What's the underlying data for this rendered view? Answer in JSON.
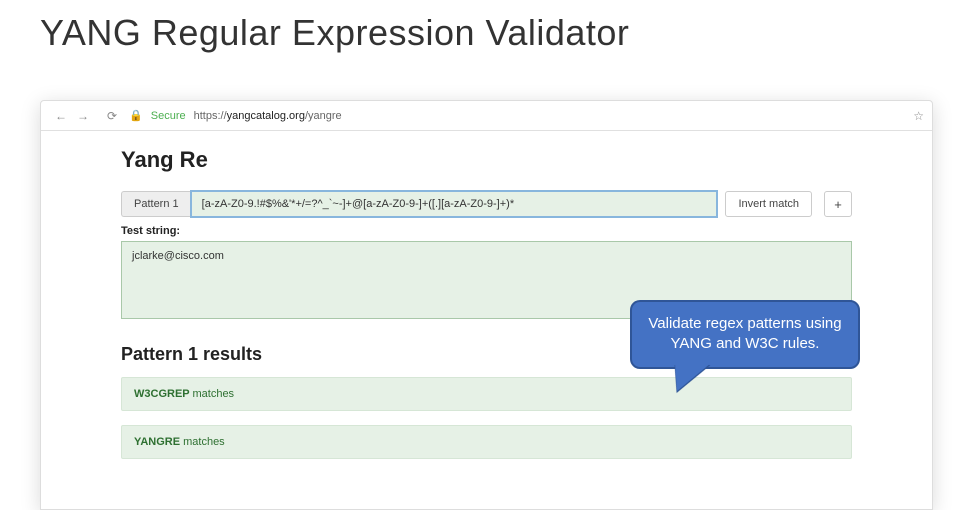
{
  "slide": {
    "title": "YANG Regular Expression Validator"
  },
  "browser": {
    "secure_label": "Secure",
    "url_prefix": "https://",
    "url_domain": "yangcatalog.org",
    "url_path": "/yangre"
  },
  "page": {
    "title": "Yang Re",
    "pattern_label": "Pattern 1",
    "pattern_value": "[a-zA-Z0-9.!#$%&'*+/=?^_`~-]+@[a-zA-Z0-9-]+([.][a-zA-Z0-9-]+)*",
    "invert_label": "Invert match",
    "add_label": "+",
    "test_label": "Test string:",
    "test_value": "jclarke@cisco.com",
    "results_title": "Pattern 1 results",
    "results": [
      {
        "engine": "W3CGREP",
        "status": "matches"
      },
      {
        "engine": "YANGRE",
        "status": "matches"
      }
    ]
  },
  "callout": {
    "text": "Validate regex patterns using YANG and W3C rules."
  }
}
